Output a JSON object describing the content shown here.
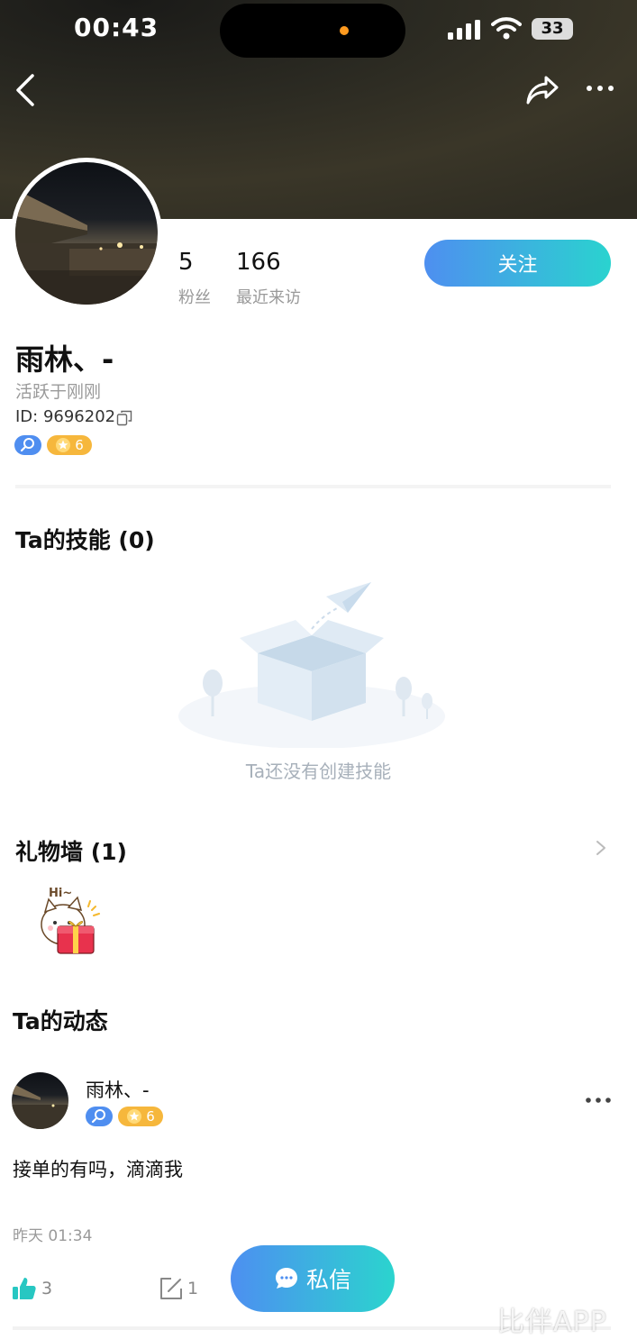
{
  "status_bar": {
    "time": "00:43",
    "battery": "33"
  },
  "profile": {
    "followers_count": "5",
    "followers_label": "粉丝",
    "visitors_count": "166",
    "visitors_label": "最近来访",
    "follow_label": "关注",
    "name": "雨林、-",
    "active": "活跃于刚刚",
    "id_text": "ID: 9696202",
    "level": "6"
  },
  "skills": {
    "title": "Ta的技能 (0)",
    "empty_text": "Ta还没有创建技能"
  },
  "gifts": {
    "title": "礼物墙 (1)",
    "gift_hi": "Hi~"
  },
  "moments": {
    "title": "Ta的动态",
    "post": {
      "author": "雨林、-",
      "level": "6",
      "text": "接单的有吗，滴滴我",
      "time": "昨天 01:34",
      "likes": "3",
      "comments": "1"
    }
  },
  "message_button": "私信",
  "watermark": "比伴APP",
  "colors": {
    "accent_start": "#4e8ff0",
    "accent_end": "#2ad3cf",
    "muted": "#9a9a9a"
  }
}
